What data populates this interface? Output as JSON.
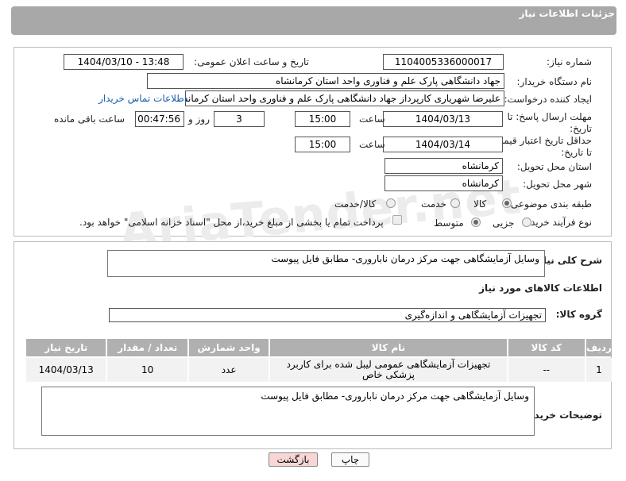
{
  "header": {
    "title": "جزئیات اطلاعات نیاز"
  },
  "watermark": "AriaTender.net",
  "form": {
    "need_number_label": "شماره نیاز:",
    "need_number": "1104005336000017",
    "announce_label": "تاریخ و ساعت اعلان عمومی:",
    "announce_value": "1404/03/10 - 13:48",
    "buyer_org_label": "نام دستگاه خریدار:",
    "buyer_org": "جهاد دانشگاهی پارک علم و فناوری واحد استان کرمانشاه",
    "requester_label": "ایجاد کننده درخواست:",
    "requester": "علیرضا شهریاری کارپرداز جهاد دانشگاهی پارک علم و فناوری واحد استان کرمانشاه",
    "contact_link": "اطلاعات تماس خریدار",
    "deadline_label": "مهلت ارسال پاسخ: تا تاریخ:",
    "deadline_date": "1404/03/13",
    "time_label": "ساعت",
    "deadline_time": "15:00",
    "days_value": "3",
    "days_label": "روز و",
    "remaining_value": "00:47:56",
    "remaining_label": "ساعت باقی مانده",
    "price_validity_label": "حداقل تاریخ اعتبار قیمت: تا تاریخ:",
    "price_validity_date": "1404/03/14",
    "price_validity_time": "15:00",
    "province_label": "استان محل تحویل:",
    "province": "کرمانشاه",
    "city_label": "شهر محل تحویل:",
    "city": "کرمانشاه",
    "category_label": "طبقه بندی موضوعی:",
    "category_options": [
      "کالا",
      "خدمت",
      "کالا/خدمت"
    ],
    "process_label": "نوع فرآیند خرید :",
    "process_options": [
      "جزیی",
      "متوسط"
    ],
    "payment_note": "پرداخت تمام یا بخشی از مبلغ خرید،از محل \"اسناد خزانه اسلامی\" خواهد بود."
  },
  "details": {
    "general_desc_label": "شرح کلی نیاز:",
    "general_desc": "وسایل آزمایشگاهی جهت مرکز درمان ناباروری- مطابق فایل پیوست",
    "goods_info_title": "اطلاعات کالاهای مورد نیاز",
    "goods_group_label": "گروه کالا:",
    "goods_group": "تجهیزات آزمایشگاهی و اندازه‌گیری",
    "table": {
      "headers": [
        "ردیف",
        "کد کالا",
        "نام کالا",
        "واحد شمارش",
        "تعداد / مقدار",
        "تاریخ نیاز"
      ],
      "rows": [
        [
          "1",
          "--",
          "تجهیزات آزمایشگاهی عمومی لیبل شده برای کاربرد پزشکی خاص",
          "عدد",
          "10",
          "1404/03/13"
        ]
      ]
    },
    "buyer_notes_label": "توضیحات خریدار:",
    "buyer_notes": "وسایل آزمایشگاهی جهت مرکز درمان ناباروری- مطابق فایل پیوست"
  },
  "buttons": {
    "print": "چاپ",
    "back": "بازگشت"
  }
}
